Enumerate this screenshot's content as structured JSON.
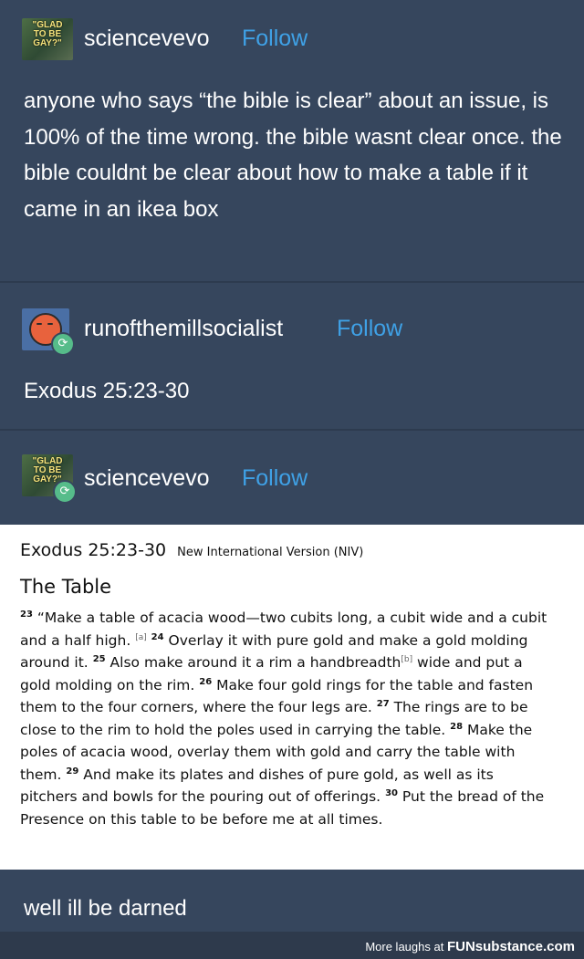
{
  "posts": [
    {
      "username": "sciencevevo",
      "follow_label": "Follow",
      "avatar_text": "\"GLAD TO BE GAY?\"",
      "text": "anyone who says “the bible is clear” about an issue, is 100% of the time wrong. the bible wasnt clear once. the bible couldnt be clear about how to make a table if it came in an ikea box"
    },
    {
      "username": "runofthemillsocialist",
      "follow_label": "Follow",
      "text": "Exodus 25:23-30"
    },
    {
      "username": "sciencevevo",
      "follow_label": "Follow",
      "avatar_text": "\"GLAD TO BE GAY?\"",
      "text": "well ill be darned"
    }
  ],
  "bible": {
    "reference": "Exodus 25:23-30",
    "version": "New International Version (NIV)",
    "heading": "The Table",
    "verses": [
      {
        "num": "23",
        "text": "“Make a table of acacia wood—two cubits long, a cubit wide and a cubit and a half high.",
        "fn": "[a]"
      },
      {
        "num": "24",
        "text": "Overlay it with pure gold and make a gold molding around it."
      },
      {
        "num": "25",
        "text": "Also make around it a rim a handbreadth",
        "fn": "[b]",
        "after": " wide and put a gold molding on the rim."
      },
      {
        "num": "26",
        "text": "Make four gold rings for the table and fasten them to the four corners, where the four legs are."
      },
      {
        "num": "27",
        "text": "The rings are to be close to the rim to hold the poles used in carrying the table."
      },
      {
        "num": "28",
        "text": "Make the poles of acacia wood, overlay them with gold and carry the table with them."
      },
      {
        "num": "29",
        "text": "And make its plates and dishes of pure gold, as well as its pitchers and bowls for the pouring out of offerings."
      },
      {
        "num": "30",
        "text": "Put the bread of the Presence on this table to be before me at all times."
      }
    ]
  },
  "footer": {
    "prefix": "More laughs at",
    "brand": "FUNsubstance.com"
  },
  "icons": {
    "reblog": "reblog-icon"
  },
  "colors": {
    "background": "#36465d",
    "follow": "#3fa1e6",
    "reblog_badge": "#56bc8a"
  }
}
